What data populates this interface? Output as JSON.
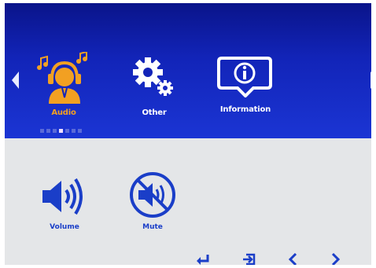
{
  "main_menu": {
    "items": [
      {
        "label": "Audio",
        "icon": "headset-person-icon",
        "selected": true
      },
      {
        "label": "Other",
        "icon": "gears-icon",
        "selected": false
      },
      {
        "label": "Information",
        "icon": "info-bubble-icon",
        "selected": false
      }
    ],
    "page_count": 7,
    "active_page": 4
  },
  "audio_menu": {
    "items": [
      {
        "label": "Volume",
        "icon": "speaker-volume-icon"
      },
      {
        "label": "Mute",
        "icon": "speaker-mute-icon"
      }
    ]
  },
  "nav_buttons": [
    {
      "name": "enter-icon"
    },
    {
      "name": "exit-icon"
    },
    {
      "name": "left-chevron-icon"
    },
    {
      "name": "right-chevron-icon"
    }
  ],
  "colors": {
    "panel_blue": "#1a2fc8",
    "selected_orange": "#f2a022",
    "icon_blue": "#1a3ec8",
    "background_grey": "#e4e6e8"
  }
}
